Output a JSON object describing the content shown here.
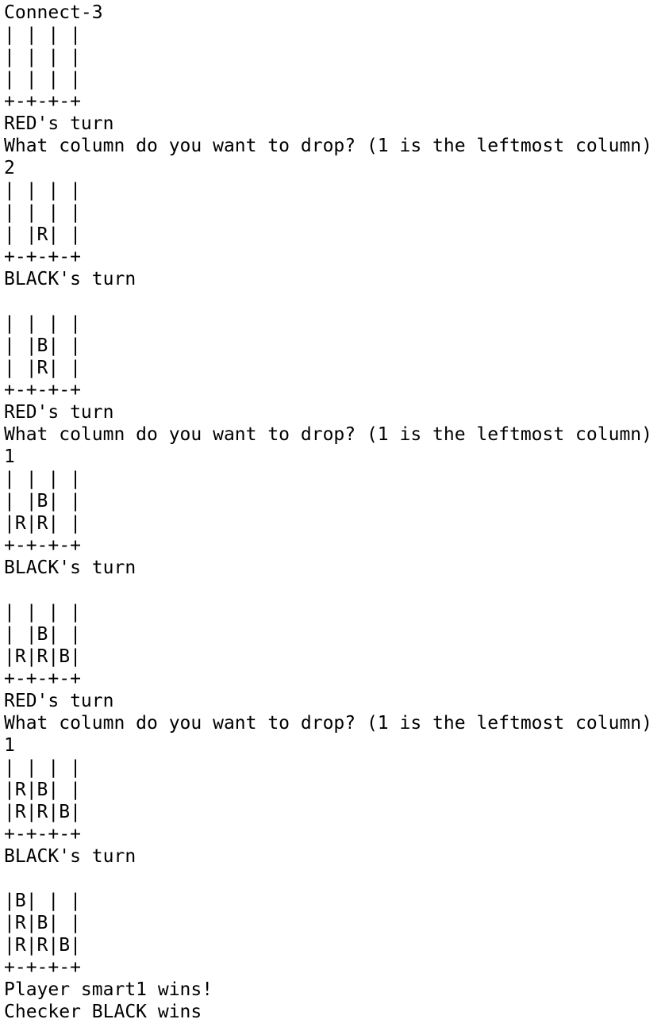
{
  "terminal": {
    "lines": [
      "Connect-3",
      "| | | |",
      "| | | |",
      "| | | |",
      "+-+-+-+",
      "RED's turn",
      "What column do you want to drop? (1 is the leftmost column)",
      "2",
      "| | | |",
      "| | | |",
      "| |R| |",
      "+-+-+-+",
      "BLACK's turn",
      "",
      "| | | |",
      "| |B| |",
      "| |R| |",
      "+-+-+-+",
      "RED's turn",
      "What column do you want to drop? (1 is the leftmost column)",
      "1",
      "| | | |",
      "| |B| |",
      "|R|R| |",
      "+-+-+-+",
      "BLACK's turn",
      "",
      "| | | |",
      "| |B| |",
      "|R|R|B|",
      "+-+-+-+",
      "RED's turn",
      "What column do you want to drop? (1 is the leftmost column)",
      "1",
      "| | | |",
      "|R|B| |",
      "|R|R|B|",
      "+-+-+-+",
      "BLACK's turn",
      "",
      "|B| | |",
      "|R|B| |",
      "|R|R|B|",
      "+-+-+-+",
      "Player smart1 wins!",
      "Checker BLACK wins"
    ]
  }
}
